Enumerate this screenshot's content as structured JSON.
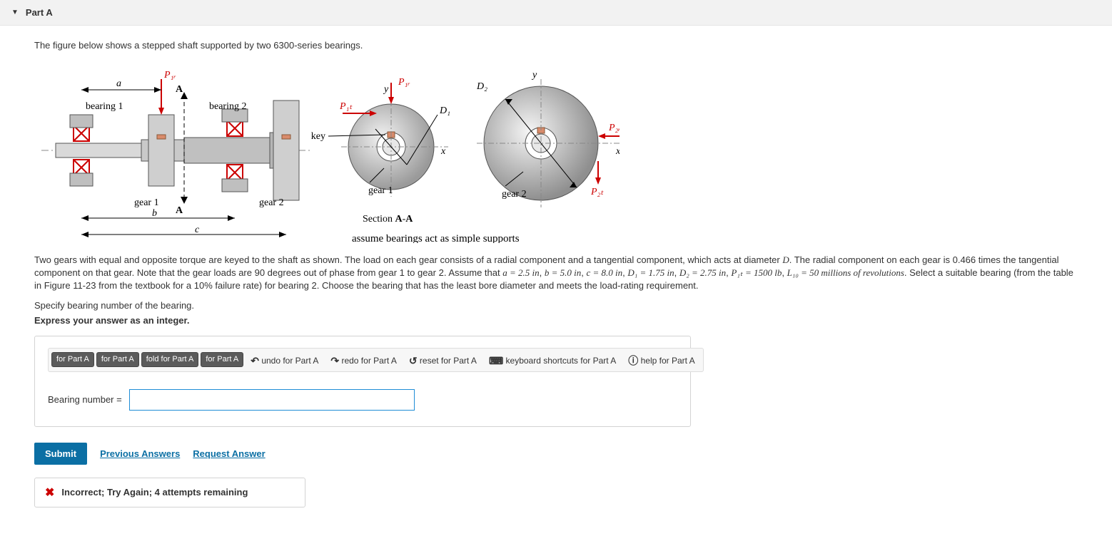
{
  "header": {
    "title": "Part A"
  },
  "intro": "The figure below shows a stepped shaft supported by two 6300-series bearings.",
  "figure": {
    "labels": {
      "P1r": "P₁ᵣ",
      "P1t": "P₁ₜ",
      "P2r": "P₂ᵣ",
      "P2t": "P₂ₜ",
      "A": "A",
      "a": "a",
      "b": "b",
      "c": "c",
      "bearing1": "bearing 1",
      "bearing2": "bearing 2",
      "gear1": "gear 1",
      "gear2": "gear 2",
      "key": "key",
      "D1": "D₁",
      "D2": "D₂",
      "x": "x",
      "y": "y",
      "section": "Section A-A",
      "assume": "assume bearings act as simple supports"
    }
  },
  "problem": {
    "text_before": "Two gears with equal and opposite torque are keyed to the shaft as shown. The load on each gear consists of a radial component and a tangential component, which acts at diameter ",
    "D": "D",
    "text_mid1": ". The radial component on each gear is 0.466 times the tangential component on that gear. Note that the gear loads are 90 degrees out of phase from gear 1 to gear 2. Assume that ",
    "eq_a": "a = 2.5 in",
    "eq_b": "b = 5.0 in",
    "eq_c": "c = 8.0 in",
    "eq_D1": "D₁ = 1.75 in",
    "eq_D2": "D₂ = 2.75 in",
    "eq_P1t": "P₁ₜ = 1500 lb",
    "eq_L10": "L₁₀ = 50 millions of revolutions",
    "text_after": ". Select a suitable bearing (from the table in Figure 11-23 from the textbook for a 10% failure rate) for bearing 2. Choose the bearing that has the least bore diameter and meets the load-rating requirement."
  },
  "specify": "Specify bearing number of the bearing.",
  "express": "Express your answer as an integer.",
  "toolbar": {
    "tpl": "Templates for Part A",
    "sym": "Symbols for Part A",
    "fold": "fold for Part A",
    "fortA": "for Part A",
    "undo": "undo for Part A",
    "redo": "redo for Part A",
    "reset": "reset for Part A",
    "kbd": "keyboard shortcuts for Part A",
    "help": "help for Part A"
  },
  "input": {
    "label": "Bearing number =",
    "value": ""
  },
  "actions": {
    "submit": "Submit",
    "prev": "Previous Answers",
    "req": "Request Answer"
  },
  "feedback": {
    "msg": "Incorrect; Try Again; 4 attempts remaining"
  }
}
